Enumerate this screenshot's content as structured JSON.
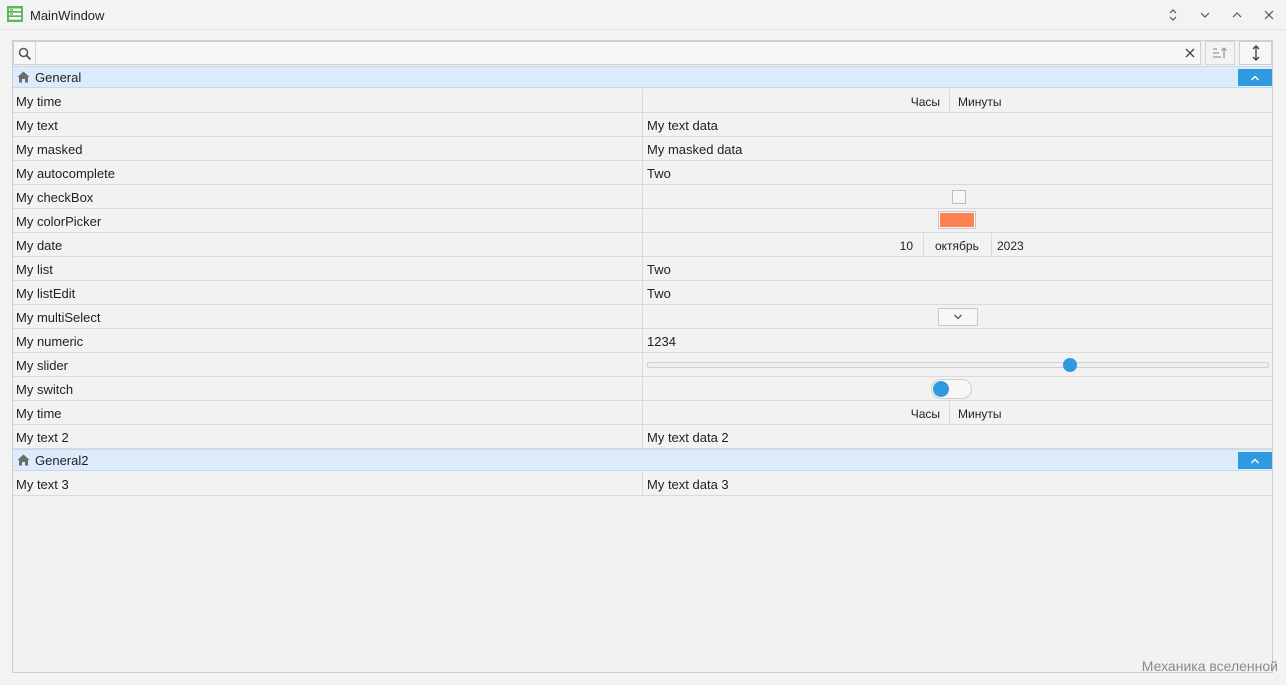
{
  "window": {
    "title": "MainWindow",
    "controls": [
      "chevron-up-down-icon",
      "minimize-icon",
      "maximize-icon",
      "close-icon"
    ]
  },
  "toolbar": {
    "search_value": "",
    "search_placeholder": ""
  },
  "colors": {
    "accent": "#2f9ae0",
    "group_header_bg": "#dcecfc",
    "color_picker_value": "#ff8050"
  },
  "groups": [
    {
      "title": "General",
      "rows": [
        {
          "label": "My time",
          "kind": "time",
          "hours": "Часы",
          "minutes": "Минуты"
        },
        {
          "label": "My text",
          "kind": "text",
          "value": "My text data"
        },
        {
          "label": "My masked",
          "kind": "text",
          "value": "My masked data"
        },
        {
          "label": "My autocomplete",
          "kind": "text",
          "value": "Two"
        },
        {
          "label": "My checkBox",
          "kind": "checkbox",
          "checked": false
        },
        {
          "label": "My colorPicker",
          "kind": "color"
        },
        {
          "label": "My date",
          "kind": "date",
          "day": "10",
          "month": "октябрь",
          "year": "2023"
        },
        {
          "label": "My list",
          "kind": "text",
          "value": "Two"
        },
        {
          "label": "My listEdit",
          "kind": "text",
          "value": "Two"
        },
        {
          "label": "My multiSelect",
          "kind": "multiselect"
        },
        {
          "label": "My numeric",
          "kind": "text",
          "value": "1234"
        },
        {
          "label": "My slider",
          "kind": "slider",
          "fraction": 0.68
        },
        {
          "label": "My switch",
          "kind": "switch",
          "on": false
        },
        {
          "label": "My time",
          "kind": "time",
          "hours": "Часы",
          "minutes": "Минуты"
        },
        {
          "label": "My text 2",
          "kind": "text",
          "value": "My text data 2"
        }
      ]
    },
    {
      "title": "General2",
      "rows": [
        {
          "label": "My text 3",
          "kind": "text",
          "value": "My text data 3"
        }
      ]
    }
  ],
  "footer": {
    "watermark": "Механика вселенной"
  }
}
